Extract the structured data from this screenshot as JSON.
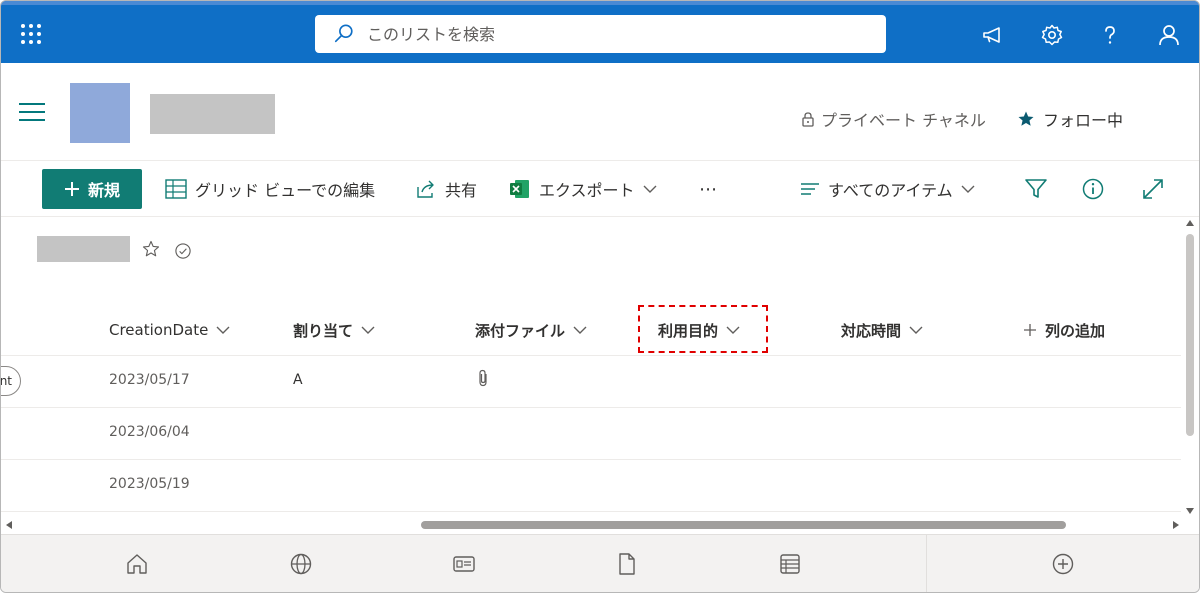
{
  "topbar": {
    "search_placeholder": "このリストを検索",
    "icons": [
      "app-launcher-icon",
      "search-icon",
      "megaphone-icon",
      "gear-icon",
      "help-icon",
      "person-icon"
    ]
  },
  "site_header": {
    "private_channel": "プライベート チャネル",
    "follow": "フォロー中"
  },
  "command_bar": {
    "new_label": "新規",
    "grid_edit": "グリッド ビューでの編集",
    "share": "共有",
    "export": "エクスポート",
    "more": "⋯",
    "view": "すべてのアイテム"
  },
  "table": {
    "columns": [
      "CreationDate",
      "割り当て",
      "添付ファイル",
      "利用目的",
      "対応時間"
    ],
    "add_column": "列の追加",
    "row_chip": "nt",
    "rows": [
      {
        "date": "2023/05/17",
        "assigned": "A",
        "attachment": true
      },
      {
        "date": "2023/06/04",
        "assigned": "",
        "attachment": false
      },
      {
        "date": "2023/05/19",
        "assigned": "",
        "attachment": false
      }
    ]
  },
  "colors": {
    "suite_bar": "#0f6fc6",
    "accent_teal": "#117c74",
    "highlight": "#e00000"
  }
}
